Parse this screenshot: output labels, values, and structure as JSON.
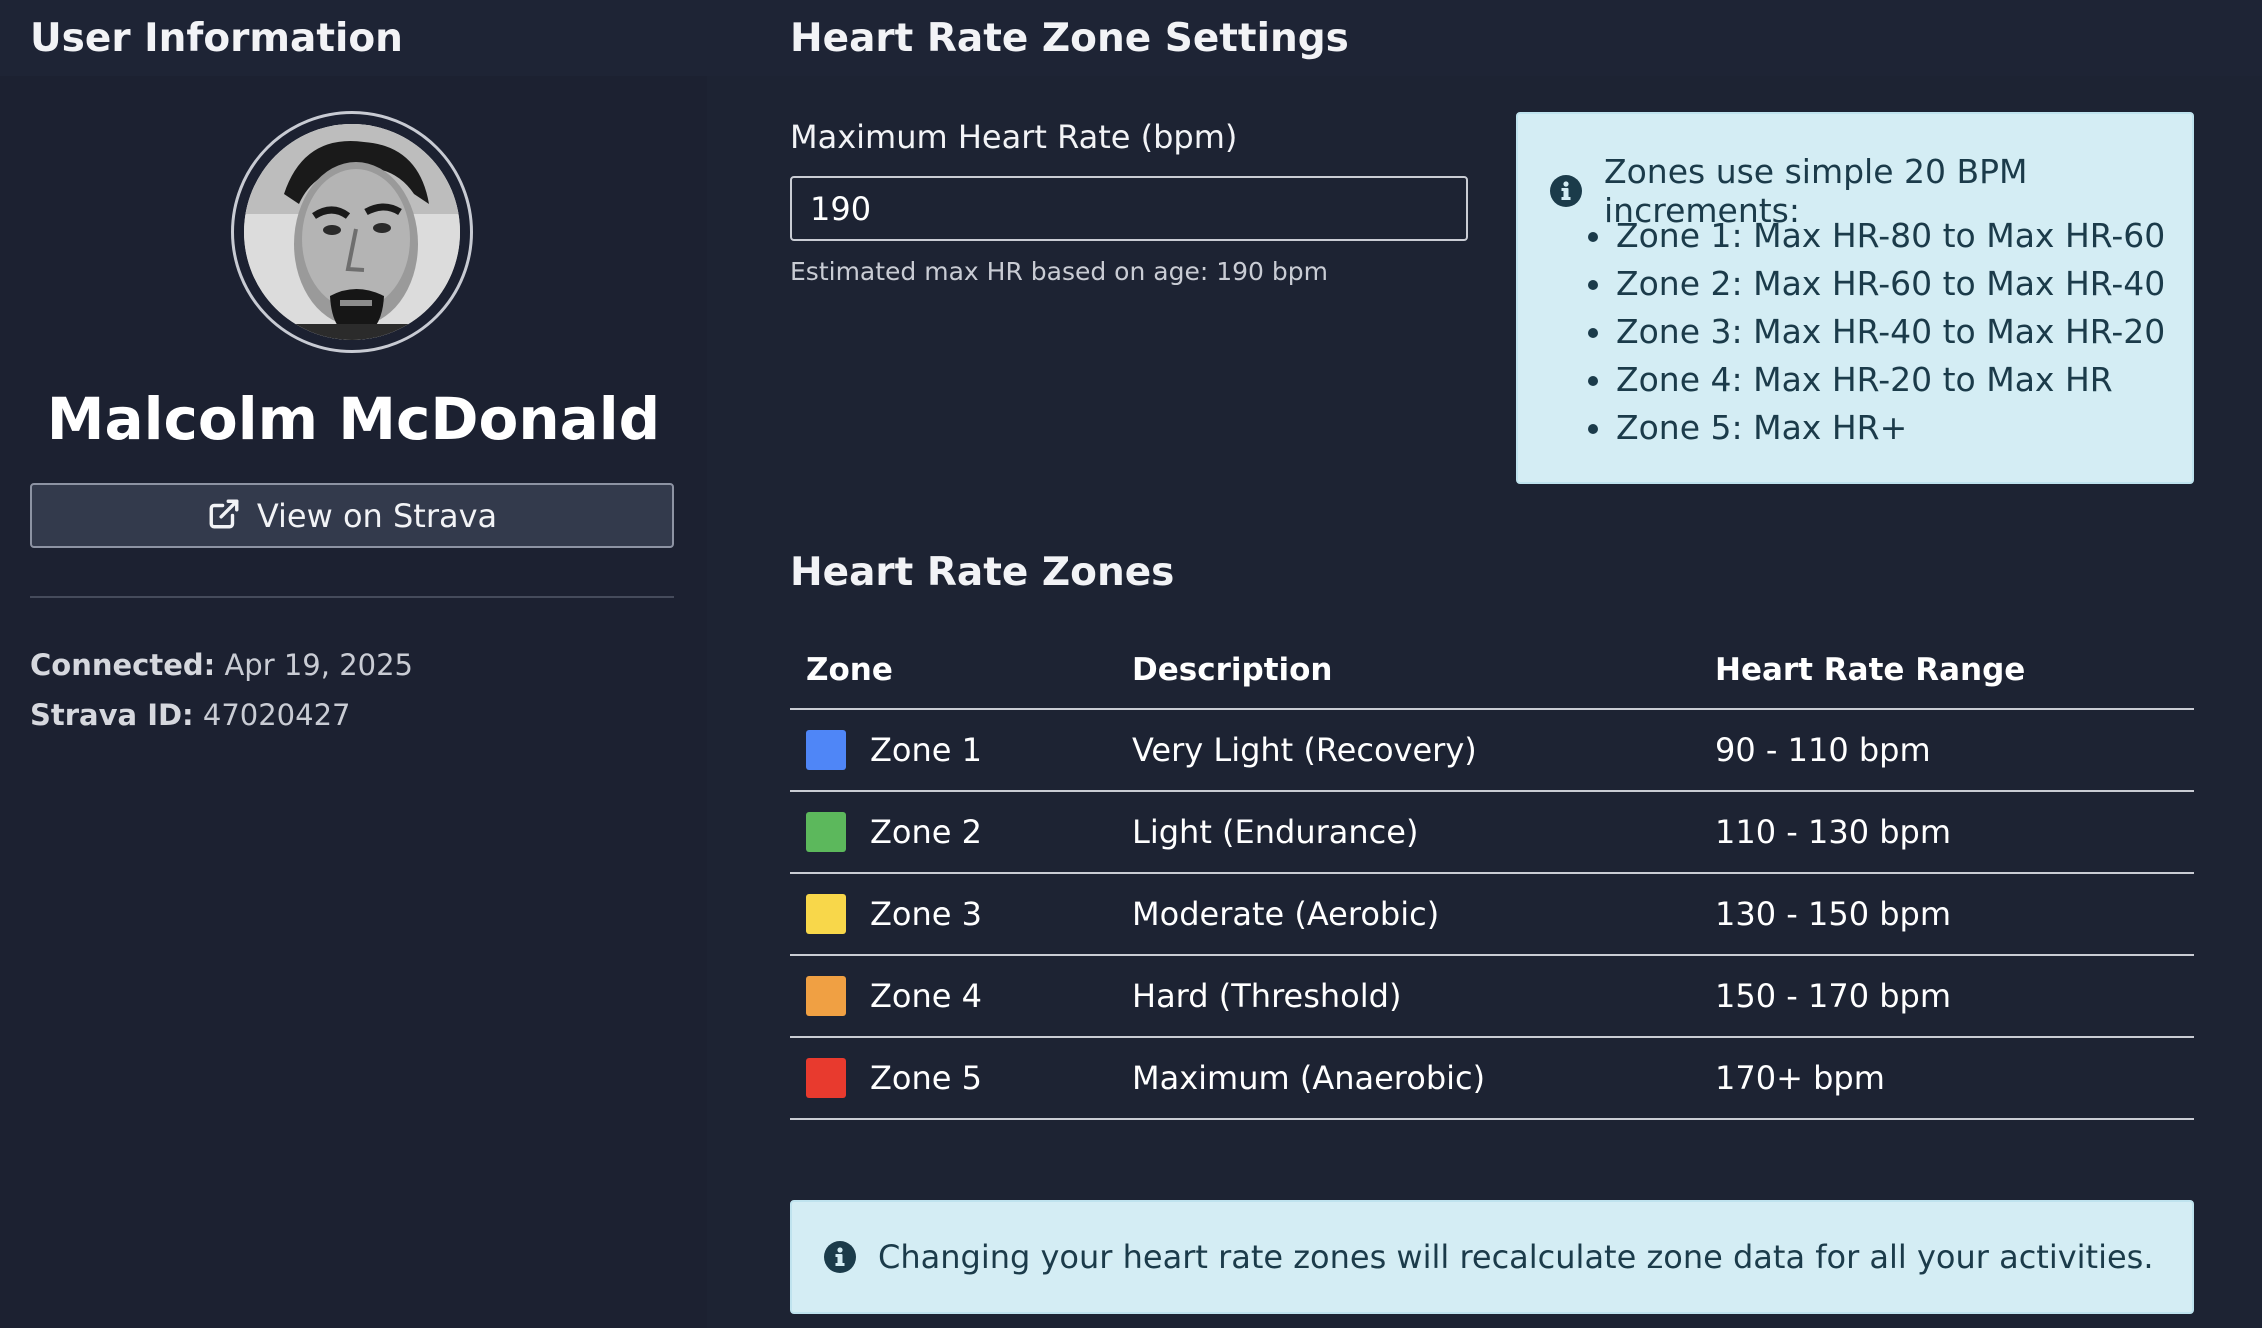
{
  "user_panel": {
    "title": "User Information",
    "name": "Malcolm McDonald",
    "strava_button_label": "View on Strava",
    "connected_label": "Connected:",
    "connected_value": "Apr 19, 2025",
    "strava_id_label": "Strava ID:",
    "strava_id_value": "47020427"
  },
  "settings": {
    "title": "Heart Rate Zone Settings",
    "max_hr_label": "Maximum Heart Rate (bpm)",
    "max_hr_value": "190",
    "estimate_text": "Estimated max HR based on age: 190 bpm",
    "info_heading": "Zones use simple 20 BPM increments:",
    "info_items": [
      "Zone 1: Max HR-80 to Max HR-60",
      "Zone 2: Max HR-60 to Max HR-40",
      "Zone 3: Max HR-40 to Max HR-20",
      "Zone 4: Max HR-20 to Max HR",
      "Zone 5: Max HR+"
    ]
  },
  "zones": {
    "title": "Heart Rate Zones",
    "headers": [
      "Zone",
      "Description",
      "Heart Rate Range"
    ],
    "rows": [
      {
        "zone": "Zone 1",
        "description": "Very Light (Recovery)",
        "range": "90 - 110 bpm",
        "color": "#4f86f7"
      },
      {
        "zone": "Zone 2",
        "description": "Light (Endurance)",
        "range": "110 - 130 bpm",
        "color": "#5cb85c"
      },
      {
        "zone": "Zone 3",
        "description": "Moderate (Aerobic)",
        "range": "130 - 150 bpm",
        "color": "#f8d74a"
      },
      {
        "zone": "Zone 4",
        "description": "Hard (Threshold)",
        "range": "150 - 170 bpm",
        "color": "#f0a043"
      },
      {
        "zone": "Zone 5",
        "description": "Maximum (Anaerobic)",
        "range": "170+ bpm",
        "color": "#e83a2e"
      }
    ]
  },
  "notice": {
    "text": "Changing your heart rate zones will recalculate zone data for all your activities."
  },
  "colors": {
    "background": "#1d2333",
    "info_bg": "#d4edf4",
    "info_text": "#1b3b4a"
  },
  "icons": {
    "strava_button": "external-link-icon",
    "info": "info-circle-icon"
  }
}
